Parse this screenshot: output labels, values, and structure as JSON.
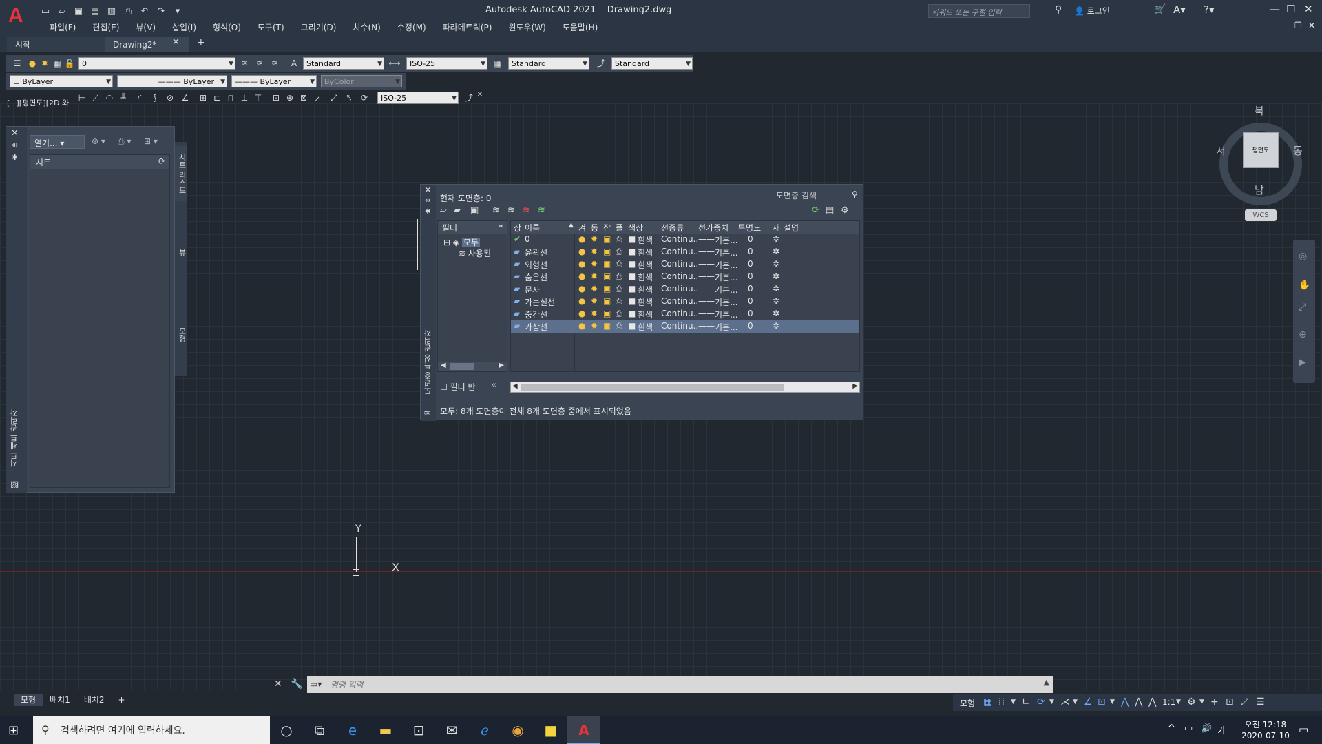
{
  "window": {
    "title": "Autodesk AutoCAD 2021    Drawing2.dwg",
    "search_placeholder": "키워드 또는 구절 입력",
    "login": "로그인",
    "controls": {
      "minimize": "—",
      "maximize": "☐",
      "close": "✕"
    }
  },
  "menu": [
    "파일(F)",
    "편집(E)",
    "뷰(V)",
    "삽입(I)",
    "형식(O)",
    "도구(T)",
    "그리기(D)",
    "치수(N)",
    "수정(M)",
    "파라메트릭(P)",
    "윈도우(W)",
    "도움말(H)"
  ],
  "file_tabs": {
    "start": "시작",
    "drawing": "Drawing2*"
  },
  "toolbar": {
    "layer_combo": "0",
    "text_style": "Standard",
    "dim_style": "ISO-25",
    "table_style": "Standard",
    "mleader_style": "Standard",
    "color_combo": "ByLayer",
    "linetype_combo": "ByLayer",
    "lineweight_combo": "ByLayer",
    "plotstyle_combo": "ByColor",
    "dim_style2": "ISO-25"
  },
  "viewport_label": "[−][평면도][2D 와",
  "sheet_set": {
    "open_label": "열기...",
    "sheets_header": "시트",
    "vertical_title": "시트 세트 관리자",
    "tabs": [
      "시트 리스트",
      "뷰",
      "모형"
    ]
  },
  "layer_manager": {
    "current_layer": "현재 도면층: 0",
    "search_placeholder": "도면층 검색",
    "vertical_title": "도면층 특성 관리자",
    "filter_header": "필터",
    "filter_all": "모두",
    "filter_used": "사용된",
    "invert_filter": "필터 반",
    "status": "모두: 8개 도면층이 전체 8개 도면층 중에서 표시되었음",
    "columns": [
      "상",
      "이름",
      "켜",
      "동",
      "잠",
      "플",
      "색상",
      "선종류",
      "선가중치",
      "투명도",
      "새",
      "설명"
    ],
    "layers": [
      {
        "name": "0",
        "color": "흰색",
        "linetype": "Continu...",
        "lineweight": "기본...",
        "transparency": "0",
        "current": true
      },
      {
        "name": "윤곽선",
        "color": "흰색",
        "linetype": "Continu...",
        "lineweight": "기본...",
        "transparency": "0"
      },
      {
        "name": "외형선",
        "color": "흰색",
        "linetype": "Continu...",
        "lineweight": "기본...",
        "transparency": "0"
      },
      {
        "name": "숨은선",
        "color": "흰색",
        "linetype": "Continu...",
        "lineweight": "기본...",
        "transparency": "0"
      },
      {
        "name": "문자",
        "color": "흰색",
        "linetype": "Continu...",
        "lineweight": "기본...",
        "transparency": "0"
      },
      {
        "name": "가는실선",
        "color": "흰색",
        "linetype": "Continu...",
        "lineweight": "기본...",
        "transparency": "0"
      },
      {
        "name": "중간선",
        "color": "흰색",
        "linetype": "Continu...",
        "lineweight": "기본...",
        "transparency": "0"
      },
      {
        "name": "가상선",
        "color": "흰색",
        "linetype": "Continu...",
        "lineweight": "기본...",
        "transparency": "0",
        "selected": true
      }
    ]
  },
  "viewcube": {
    "north": "북",
    "south": "남",
    "east": "동",
    "west": "서",
    "face": "평면도",
    "wcs": "WCS"
  },
  "ucs": {
    "y": "Y",
    "x": "X"
  },
  "command": {
    "placeholder": "명령 입력"
  },
  "layout_tabs": [
    "모형",
    "배치1",
    "배치2",
    "+"
  ],
  "status_bar": {
    "model": "모형",
    "scale": "1:1"
  },
  "taskbar": {
    "search_placeholder": "검색하려면 여기에 입력하세요.",
    "time": "오전 12:18",
    "date": "2020-07-10",
    "ime": "가"
  },
  "colors": {
    "accent": "#6fa8ff",
    "selection": "#5c6f8c",
    "autocad_red": "#e8333a"
  }
}
